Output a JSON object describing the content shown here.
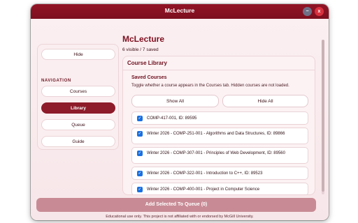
{
  "window": {
    "title": "McLecture",
    "minimize": "−",
    "close": "x"
  },
  "sidebar": {
    "hide_label": "Hide",
    "nav_heading": "NAVIGATION",
    "items": [
      {
        "label": "Courses",
        "active": false
      },
      {
        "label": "Library",
        "active": true
      },
      {
        "label": "Queue",
        "active": false
      },
      {
        "label": "Guide",
        "active": false
      }
    ]
  },
  "main": {
    "title": "McLecture",
    "status": "6 visible / 7 saved",
    "panel": {
      "title": "Course Library",
      "section_title": "Saved Courses",
      "description": "Toggle whether a course appears in the Courses tab. Hidden courses are not loaded.",
      "show_all_label": "Show All",
      "hide_all_label": "Hide All",
      "courses": [
        {
          "label": "COMP-417-001, ID: 89595",
          "checked": true
        },
        {
          "label": "Winter 2026 - COMP-251-001 - Algorithms and Data Structures, ID: 89866",
          "checked": true
        },
        {
          "label": "Winter 2026 - COMP-307-001 - Principles of Web Development, ID: 89560",
          "checked": true
        },
        {
          "label": "Winter 2026 - COMP-322-001 - Introduction to C++, ID: 89523",
          "checked": true
        },
        {
          "label": "Winter 2026 - COMP-400-001 - Project in Computer Science",
          "checked": true
        }
      ]
    }
  },
  "add_button_label": "Add Selected To Queue (0)",
  "footer": "Educational use only. This project is not affiliated with or endorsed by McGill University.",
  "colors": {
    "accent": "#8d1b2a",
    "titlebar": "#921526",
    "checkbox": "#1a6fdf"
  }
}
